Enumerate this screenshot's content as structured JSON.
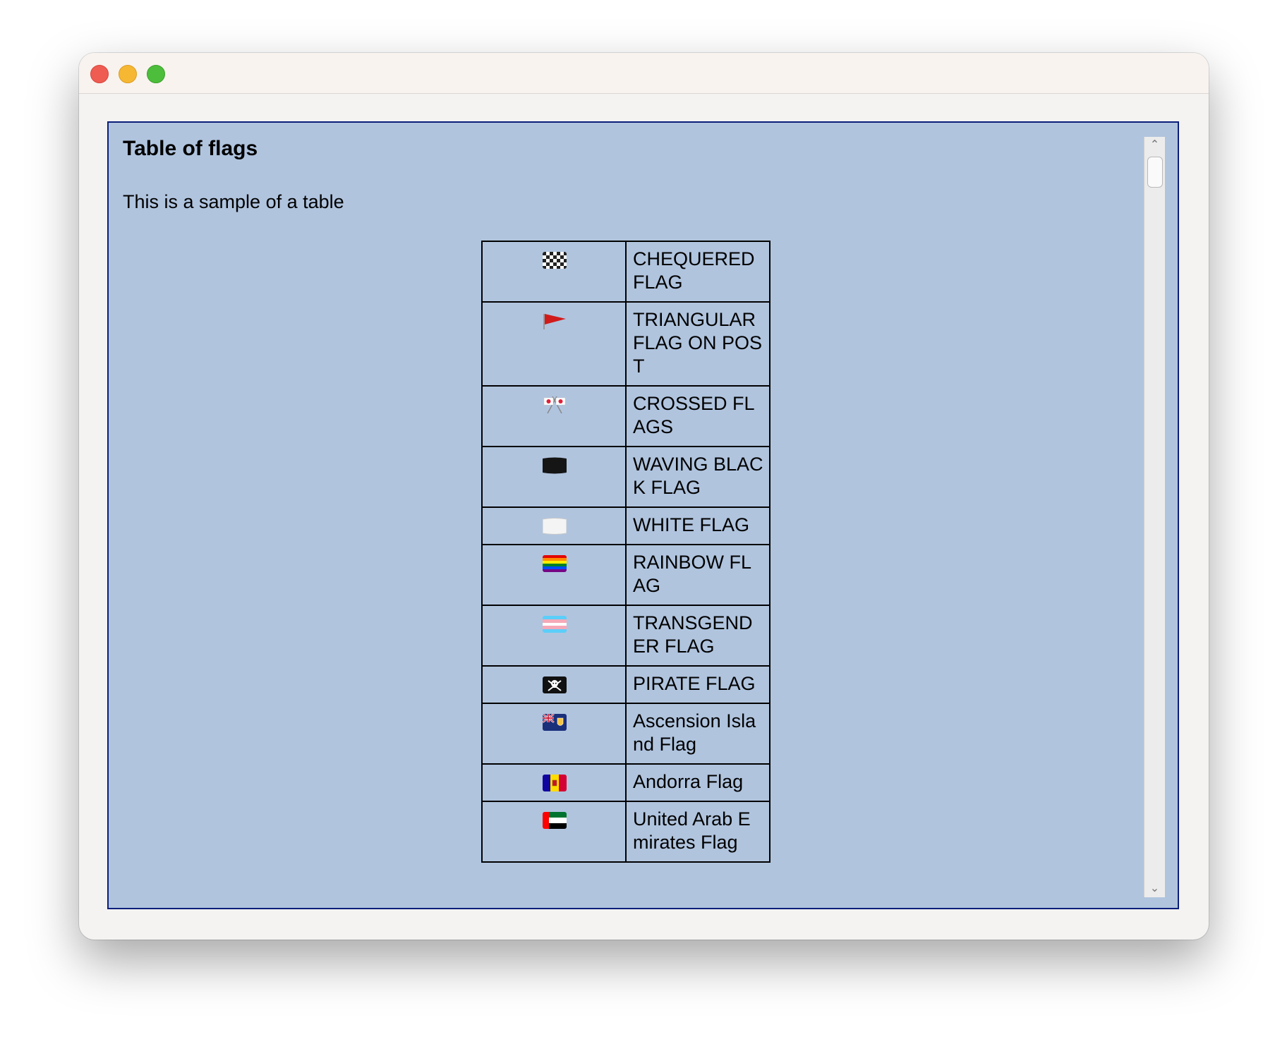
{
  "window": {
    "controls": [
      "close-button",
      "minimize-button",
      "maximize-button"
    ]
  },
  "page": {
    "heading": "Table of flags",
    "intro": "This is a sample of a table"
  },
  "flags": [
    {
      "icon": "chequered-flag-icon",
      "name": "CHEQUERED FLAG"
    },
    {
      "icon": "triangular-flag-icon",
      "name": "TRIANGULAR FLAG ON POST"
    },
    {
      "icon": "crossed-flags-icon",
      "name": "CROSSED FLAGS"
    },
    {
      "icon": "black-flag-icon",
      "name": "WAVING BLACK FLAG"
    },
    {
      "icon": "white-flag-icon",
      "name": "WHITE FLAG"
    },
    {
      "icon": "rainbow-flag-icon",
      "name": "RAINBOW FLAG"
    },
    {
      "icon": "transgender-flag-icon",
      "name": "TRANSGENDER FLAG"
    },
    {
      "icon": "pirate-flag-icon",
      "name": "PIRATE FLAG"
    },
    {
      "icon": "ascension-island-flag-icon",
      "name": "Ascension Island Flag"
    },
    {
      "icon": "andorra-flag-icon",
      "name": "Andorra Flag"
    },
    {
      "icon": "uae-flag-icon",
      "name": "United Arab Emirates Flag"
    }
  ],
  "colors": {
    "panel_background": "#b0c4de",
    "panel_border": "#0b1e79"
  }
}
